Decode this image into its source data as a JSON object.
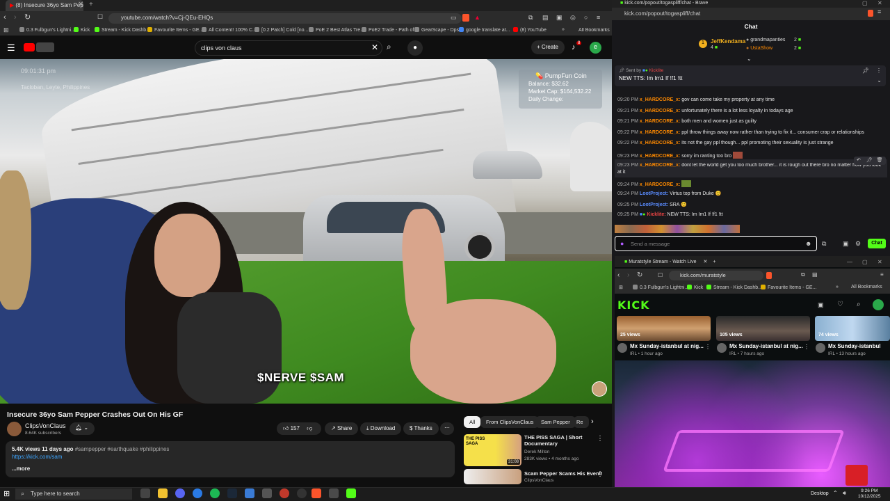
{
  "left_browser": {
    "tab_title": "(8) Insecure 36yo Sam Pepper",
    "url": "youtube.com/watch?v=Cj-QEu-EHQs",
    "bookmarks": [
      "0.3 Fulbgun's Lightni...",
      "Kick",
      "Stream - Kick Dashb...",
      "Favourite Items - GE...",
      "All Content! 100% C...",
      "[0.2 Patch] Cold [no...",
      "PoE 2 Best Atlas Tre...",
      "PoE2 Trade - Path of...",
      "GearScape - Dps",
      "google translate at...",
      "(8) YouTube"
    ],
    "all_bookmarks": "All Bookmarks"
  },
  "youtube": {
    "search_value": "clips von claus",
    "create_label": "Create",
    "notif_count": "8",
    "avatar_letter": "e",
    "overlay_time": "09:01:31 pm",
    "overlay_location": "Tacloban, Leyte, Philippines",
    "pump": {
      "title": "PumpFun Coin",
      "balance": "Balance: $32.62",
      "market_cap": "Market Cap: $164,532.22",
      "daily_change": "Daily Change:"
    },
    "video_caption": "$NERVE $SAM",
    "video_title": "Insecure 36yo Sam Pepper Crashes Out On His GF",
    "channel_name": "ClipsVonClaus",
    "subscribers": "8.64K subscribers",
    "like_count": "157",
    "share_label": "Share",
    "download_label": "Download",
    "thanks_label": "Thanks",
    "views_line": "5.4K views  11 days ago",
    "tags": "#sampepper #earthquake #philippines",
    "desc_link": "https://kick.com/sam",
    "more_label": "...more",
    "chips": [
      "All",
      "From ClipsVonClaus",
      "Sam Pepper",
      "Re"
    ],
    "recs": [
      {
        "title": "THE PISS SAGA | Short Documentary",
        "channel": "Derek Milton",
        "meta": "283K views • 4 months ago",
        "duration": "31:08",
        "thumb_text": "THE PISS SAGA"
      },
      {
        "title": "Scam Pepper Scams His Event!",
        "channel": "ClipsVonClaus",
        "meta": ""
      }
    ]
  },
  "right_browser": {
    "window_title": "kick.com/popout/togaspliff/chat - Brave",
    "url": "kick.com/popout/togaspliff/chat",
    "chat_header": "Chat",
    "leaderboard": [
      {
        "rank": "1",
        "name": "JeffKendama",
        "count": "4"
      },
      {
        "name": "grandmapanties",
        "count": "2"
      },
      {
        "name": "UstaShow",
        "count": "2"
      }
    ],
    "pinned": {
      "sent_by": "Sent by",
      "sender": "Kicklite",
      "text": "NEW TTS: Im Im1 If !f1 !tt"
    },
    "messages": [
      {
        "time": "09:20 PM",
        "user": "x_HARDCORE_x:",
        "text": " gov can come take my property at any time"
      },
      {
        "time": "09:21 PM",
        "user": "x_HARDCORE_x:",
        "text": " unfortunately there is a lot less loyalty in todays age"
      },
      {
        "time": "09:21 PM",
        "user": "x_HARDCORE_x:",
        "text": " both men and women just as guilty"
      },
      {
        "time": "09:22 PM",
        "user": "x_HARDCORE_x:",
        "text": " ppl throw things away now rather than trying to fix it... consumer crap or relationships"
      },
      {
        "time": "09:22 PM",
        "user": "x_HARDCORE_x:",
        "text": " its not the gay ppl though... ppl promoting their sexuality is just strange"
      },
      {
        "time": "09:23 PM",
        "user": "x_HARDCORE_x:",
        "text": " sorry im ranting too bro"
      },
      {
        "time": "09:23 PM",
        "user": "x_HARDCORE_x:",
        "text": " dont let the world get you too much brother... it is rough out there bro no matter how you look"
      },
      {
        "time": "",
        "user": "",
        "text": "at it"
      },
      {
        "time": "09:24 PM",
        "user": "x_HARDCORE_x:",
        "text": ""
      },
      {
        "time": "09:24 PM",
        "user": "LootProject:",
        "text": " Virtus top from Duke 😊",
        "blue": true
      },
      {
        "time": "09:25 PM",
        "user": "LootProject:",
        "text": " SRA 😊",
        "blue": true
      },
      {
        "time": "09:25 PM",
        "user": "Kicklite:",
        "text": " NEW TTS: Im Im1 If !f1 !tt",
        "red": true
      }
    ],
    "send_placeholder": "Send a message",
    "chat_button": "Chat",
    "kick_tab_title": "Muratstyle Stream - Watch Live",
    "kick_url": "kick.com/muratstyle",
    "kick_bookmarks": [
      "0.3 Fulbgun's Lightni...",
      "Kick",
      "Stream - Kick Dashb...",
      "Favourite Items - GE..."
    ],
    "kick_all_bookmarks": "All Bookmarks",
    "kick_logo": "KICK",
    "videos": [
      {
        "views": "25 views",
        "title": "Mx Sunday-istanbul at nig...",
        "meta": "IRL • 1 hour ago"
      },
      {
        "views": "105 views",
        "title": "Mx Sunday-istanbul at nig...",
        "meta": "IRL • 7 hours ago"
      },
      {
        "views": "74 views",
        "title": "Mx Sunday-istanbul",
        "meta": "IRL • 13 hours ago"
      }
    ]
  },
  "taskbar": {
    "search_placeholder": "Type here to search",
    "desktop_label": "Desktop",
    "time": "9:26 PM",
    "date": "10/12/2025"
  }
}
